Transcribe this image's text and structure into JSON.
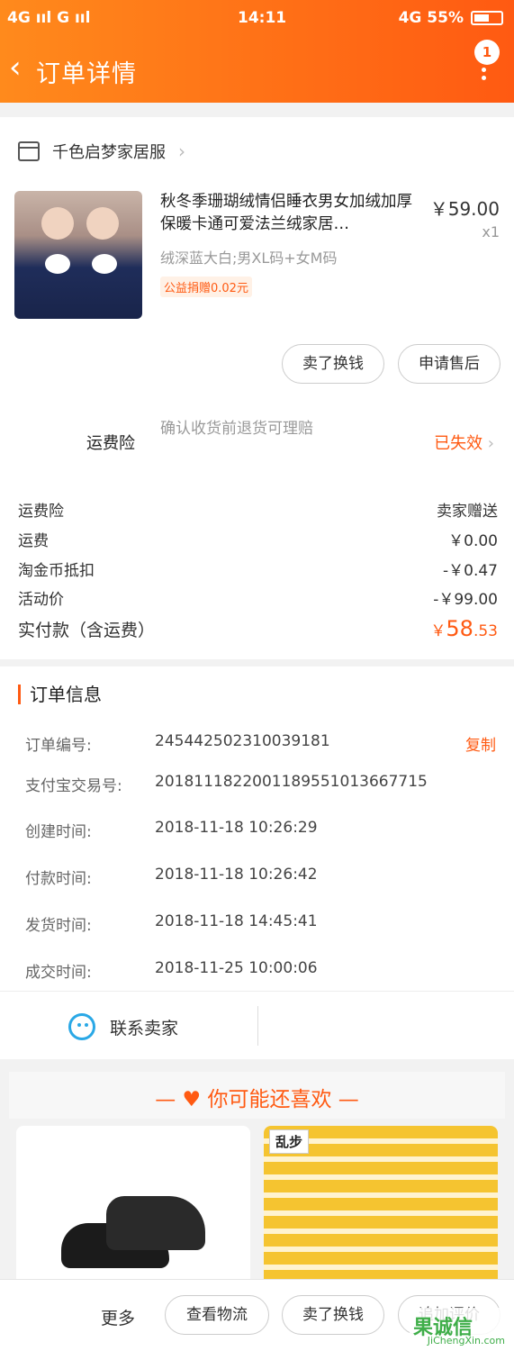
{
  "status_bar": {
    "left": "4G ııl  G ııl",
    "time": "14:11",
    "right": "4G 55%"
  },
  "header": {
    "back_glyph": "‹",
    "title": "订单详情",
    "badge": "1"
  },
  "shop": {
    "name": "千色启梦家居服"
  },
  "product": {
    "title": "秋冬季珊瑚绒情侣睡衣男女加绒加厚保暖卡通可爱法兰绒家居…",
    "price": "￥59.00",
    "qty": "x1",
    "sku": "绒深蓝大白;男XL码+女M码",
    "charity": "公益捐赠0.02元"
  },
  "actions": {
    "sell": "卖了换钱",
    "aftersale": "申请售后"
  },
  "insurance": {
    "label": "运费险",
    "desc": "确认收货前退货可理赔",
    "status": "已失效"
  },
  "fees": [
    {
      "label": "运费险",
      "value": "卖家赠送"
    },
    {
      "label": "运费",
      "value": "￥0.00"
    },
    {
      "label": "淘金币抵扣",
      "value": "-￥0.47"
    },
    {
      "label": "活动价",
      "value": "-￥99.00"
    }
  ],
  "paid": {
    "label": "实付款（含运费）",
    "currency": "￥",
    "int": "58",
    "dec": ".53"
  },
  "order_info": {
    "title": "订单信息",
    "copy": "复制",
    "rows": [
      {
        "key": "订单编号:",
        "value": "245442502310039181"
      },
      {
        "key": "支付宝交易号:",
        "value": "2018111822001189551013667715"
      },
      {
        "key": "创建时间:",
        "value": "2018-11-18 10:26:29"
      },
      {
        "key": "付款时间:",
        "value": "2018-11-18 10:26:42"
      },
      {
        "key": "发货时间:",
        "value": "2018-11-18 14:45:41"
      },
      {
        "key": "成交时间:",
        "value": "2018-11-25 10:00:06"
      }
    ]
  },
  "contact": {
    "label": "联系卖家"
  },
  "recommend": {
    "title": "— ♥ 你可能还喜欢 —",
    "tag": "乱步"
  },
  "bottom_bar": {
    "more": "更多",
    "logistics": "查看物流",
    "sell": "卖了换钱",
    "review": "追加评价"
  },
  "watermark": {
    "mark": "果诚信",
    "url": "JiChengXin.com"
  },
  "colors": {
    "accent": "#ff5a12",
    "header_start": "#ff8a1c",
    "contact_blue": "#2aa8e6"
  }
}
